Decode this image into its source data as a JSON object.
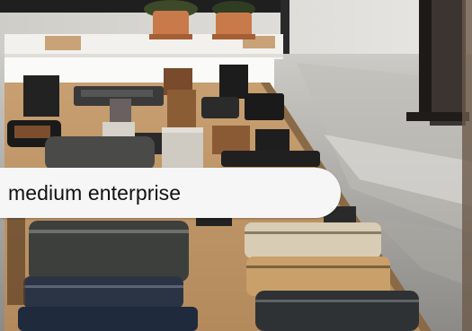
{
  "overlay": {
    "label": "medium enterprise"
  }
}
